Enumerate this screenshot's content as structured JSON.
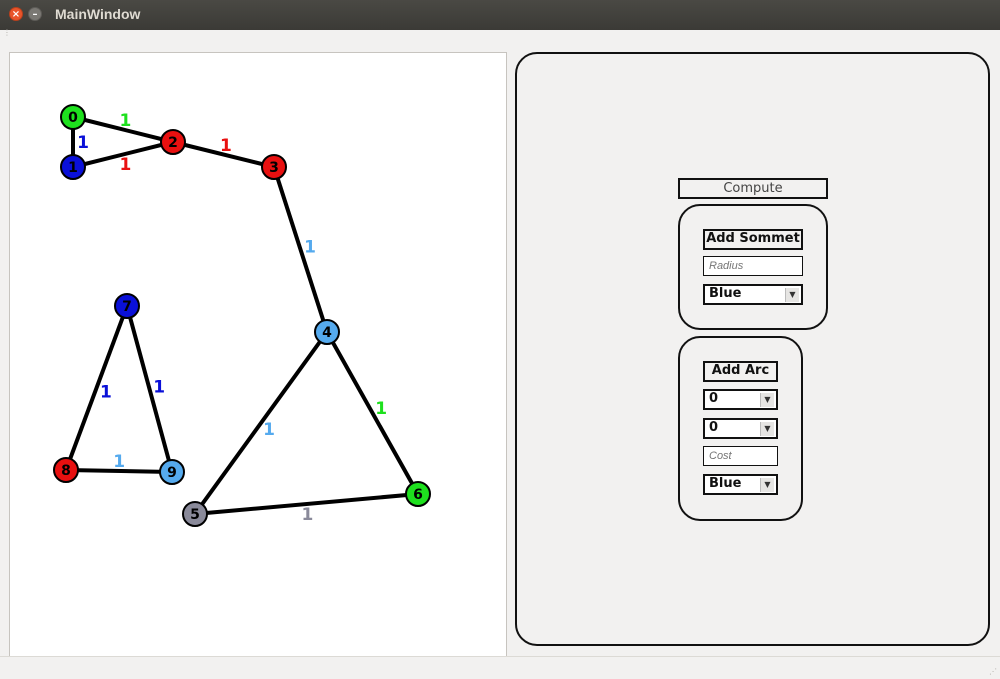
{
  "window": {
    "title": "MainWindow",
    "close_glyph": "×",
    "minimize_glyph": "–"
  },
  "graph": {
    "nodes": [
      {
        "id": "0",
        "color": "#1ee01e"
      },
      {
        "id": "1",
        "color": "#0a10d8"
      },
      {
        "id": "2",
        "color": "#e81010"
      },
      {
        "id": "3",
        "color": "#e81010"
      },
      {
        "id": "4",
        "color": "#55aaee"
      },
      {
        "id": "5",
        "color": "#8a8a9a"
      },
      {
        "id": "6",
        "color": "#1ee01e"
      },
      {
        "id": "7",
        "color": "#0a10d8"
      },
      {
        "id": "8",
        "color": "#e81010"
      },
      {
        "id": "9",
        "color": "#55aaee"
      }
    ],
    "edges": [
      {
        "from": "0",
        "to": "1",
        "cost": "1",
        "color": "#0a10d8"
      },
      {
        "from": "0",
        "to": "2",
        "cost": "1",
        "color": "#1ee01e"
      },
      {
        "from": "1",
        "to": "2",
        "cost": "1",
        "color": "#e81010"
      },
      {
        "from": "2",
        "to": "3",
        "cost": "1",
        "color": "#e81010"
      },
      {
        "from": "3",
        "to": "4",
        "cost": "1",
        "color": "#55aaee"
      },
      {
        "from": "4",
        "to": "5",
        "cost": "1",
        "color": "#55aaee"
      },
      {
        "from": "4",
        "to": "6",
        "cost": "1",
        "color": "#1ee01e"
      },
      {
        "from": "5",
        "to": "6",
        "cost": "1",
        "color": "#8a8a9a"
      },
      {
        "from": "7",
        "to": "8",
        "cost": "1",
        "color": "#0a10d8"
      },
      {
        "from": "7",
        "to": "9",
        "cost": "1",
        "color": "#0a10d8"
      },
      {
        "from": "8",
        "to": "9",
        "cost": "1",
        "color": "#55aaee"
      }
    ]
  },
  "panel": {
    "compute_label": "Compute",
    "add_sommet": {
      "button_label": "Add Sommet",
      "radius_placeholder": "Radius",
      "color_value": "Blue"
    },
    "add_arc": {
      "button_label": "Add Arc",
      "from_value": "0",
      "to_value": "0",
      "cost_placeholder": "Cost",
      "color_value": "Blue"
    },
    "dropdown_arrow": "▼"
  }
}
